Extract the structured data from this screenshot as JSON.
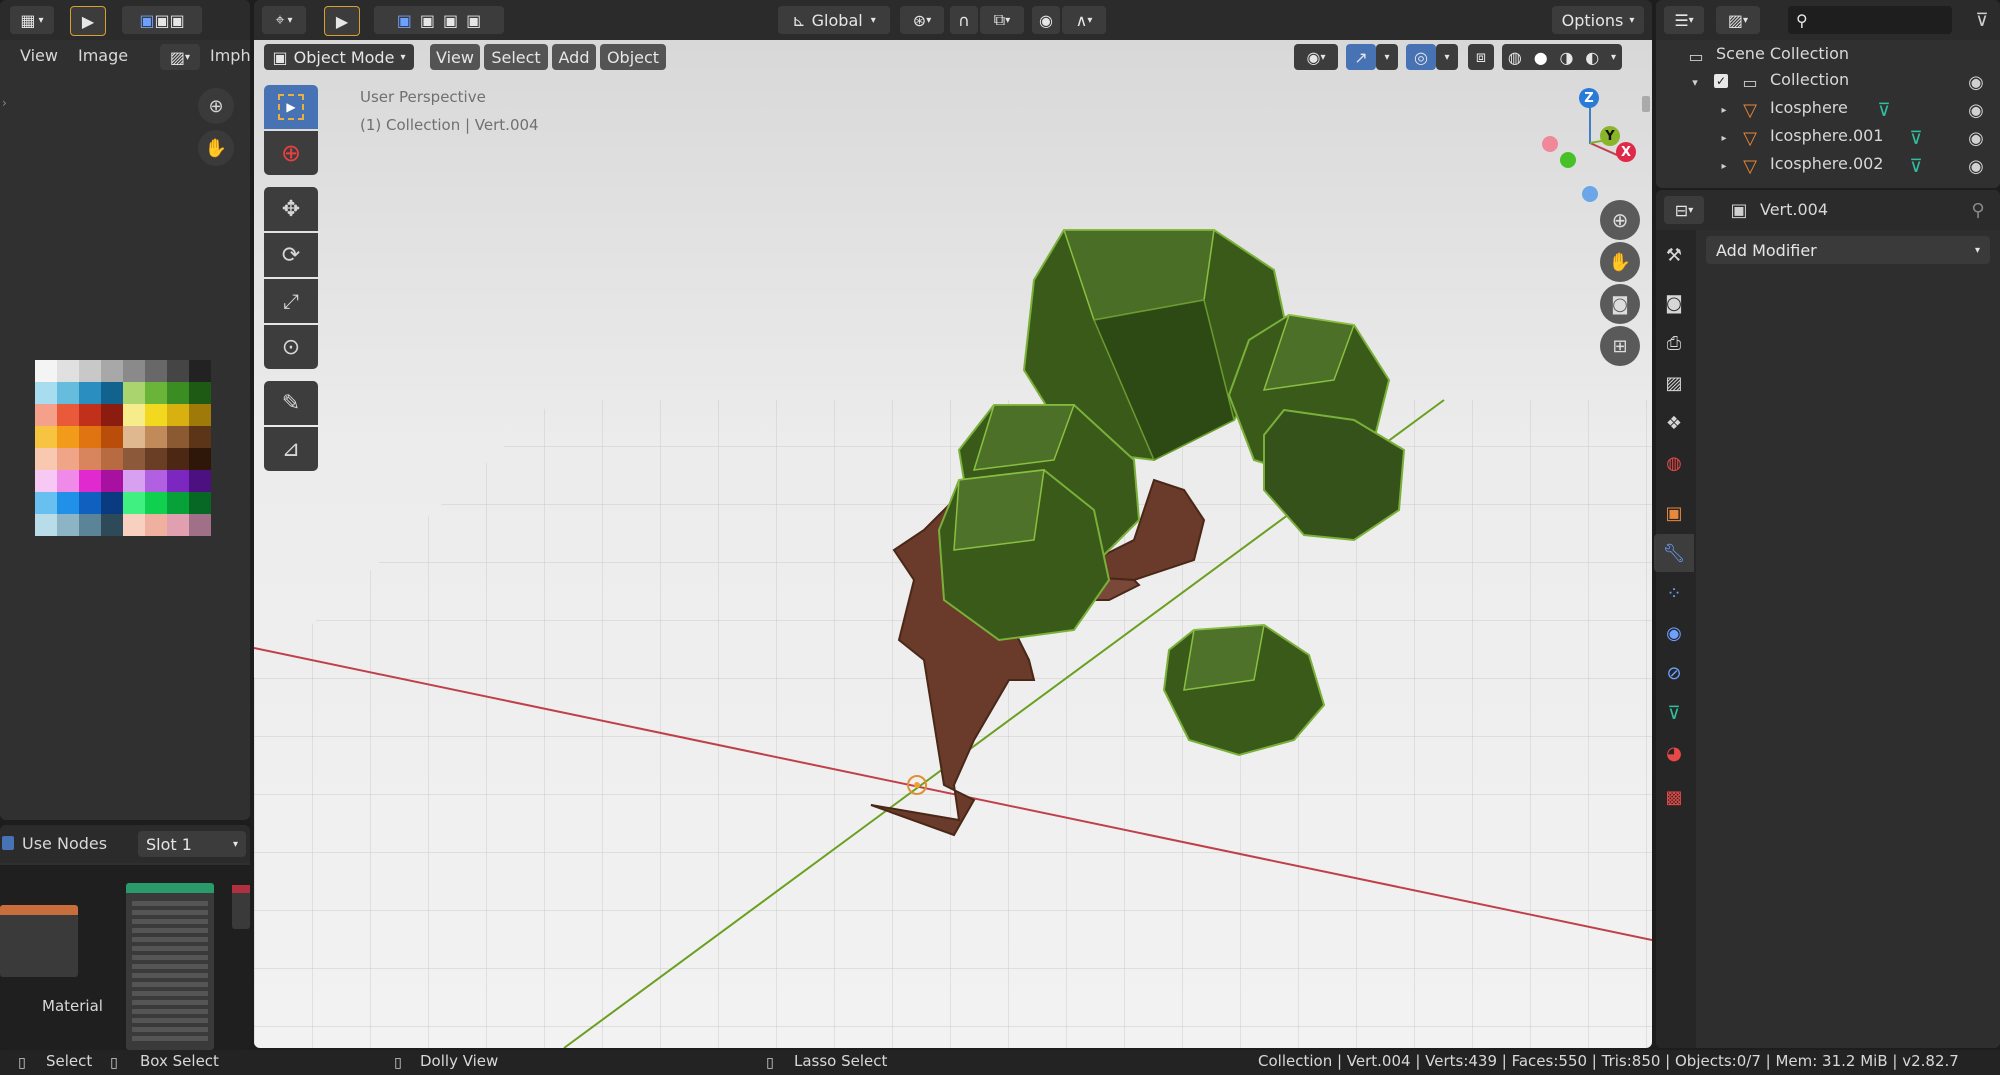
{
  "left_top": {
    "menu_view": "View",
    "menu_image": "Image",
    "name_field": "Imph"
  },
  "left_bottom": {
    "use_nodes": "Use Nodes",
    "slot": "Slot 1",
    "material_label": "Material"
  },
  "viewport_header": {
    "transform_orientation": "Global",
    "options": "Options",
    "mode": "Object Mode",
    "menu_view": "View",
    "menu_select": "Select",
    "menu_add": "Add",
    "menu_object": "Object"
  },
  "viewport": {
    "perspective_label": "User Perspective",
    "collection_label": "(1) Collection | Vert.004",
    "gizmo_axes": {
      "z": "Z",
      "y": "Y",
      "x": "X"
    }
  },
  "outliner": {
    "scene_collection": "Scene Collection",
    "collection": "Collection",
    "items": [
      {
        "name": "Icosphere"
      },
      {
        "name": "Icosphere.001"
      },
      {
        "name": "Icosphere.002"
      }
    ]
  },
  "properties": {
    "object_name": "Vert.004",
    "add_modifier": "Add Modifier"
  },
  "status_bar": {
    "select": "Select",
    "box_select": "Box Select",
    "dolly_view": "Dolly View",
    "lasso_select": "Lasso Select",
    "stats": "Collection | Vert.004 | Verts:439 | Faces:550 | Tris:850 | Objects:0/7 | Mem: 31.2 MiB | v2.82.7"
  },
  "palette": [
    [
      "#f4f4f4",
      "#e0e0e0",
      "#c8c8c8",
      "#a8a8a8",
      "#8a8a8a",
      "#686868",
      "#454545",
      "#222222"
    ],
    [
      "#a8dcef",
      "#66bcdc",
      "#2a8fc0",
      "#12628e",
      "#a9d46e",
      "#6ab43a",
      "#3b8c22",
      "#1f5a14"
    ],
    [
      "#f5a08a",
      "#e85a3a",
      "#c0301a",
      "#8c1c10",
      "#f7ec8c",
      "#f2d81e",
      "#d8b010",
      "#a07a08"
    ],
    [
      "#f7c442",
      "#f29a1a",
      "#e07410",
      "#b84e0a",
      "#e0b890",
      "#c08a5a",
      "#8c5a32",
      "#5c3418"
    ],
    [
      "#f8c8b0",
      "#f0a488",
      "#d8845c",
      "#b86a40",
      "#8c5a3a",
      "#6a3e24",
      "#4c2814",
      "#2e1608"
    ],
    [
      "#f8c8f4",
      "#f08ae8",
      "#e02ad0",
      "#a810a0",
      "#d8a0f0",
      "#b060e0",
      "#7c28c0",
      "#4c1080"
    ],
    [
      "#68c0f0",
      "#2090e8",
      "#1060c0",
      "#0a3a80",
      "#40f080",
      "#10d050",
      "#08a038",
      "#066824"
    ],
    [
      "#b8dce8",
      "#8cb4c4",
      "#5c8498",
      "#2e4a58",
      "#f8d0c0",
      "#f0b0a0",
      "#e0a0b0",
      "#a07088"
    ]
  ]
}
